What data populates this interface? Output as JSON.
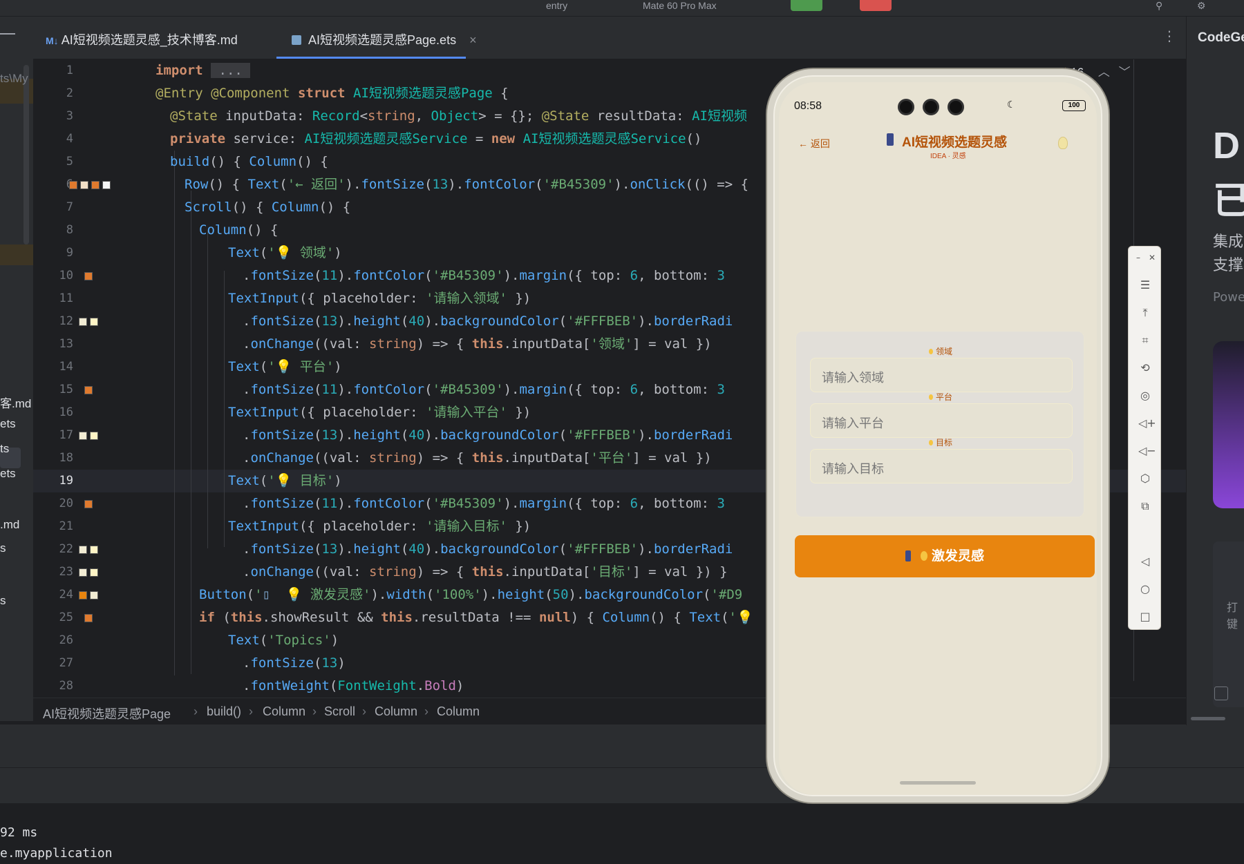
{
  "topbar": {
    "device_label": "entry",
    "target_label": "Mate 60 Pro Max"
  },
  "project_items": [
    "ts\\My",
    "客.md",
    "ets",
    "ts",
    "ets",
    ".md",
    "s",
    "s"
  ],
  "tabs": [
    {
      "icon": "M↓",
      "label": "AI短视频选题灵感_技术博客.md"
    },
    {
      "icon": "ets-file",
      "label": "AI短视频选题灵感Page.ets",
      "close": "×"
    }
  ],
  "editor": {
    "warnings": "16",
    "line_numbers": [
      "1",
      "2",
      "3",
      "4",
      "5",
      "6",
      "7",
      "8",
      "9",
      "10",
      "11",
      "12",
      "13",
      "14",
      "15",
      "16",
      "17",
      "18",
      "19",
      "20",
      "21",
      "22",
      "23",
      "24",
      "25",
      "26",
      "27",
      "28"
    ],
    "current_line": "19"
  },
  "breadcrumb": [
    "AI短视频选题灵感Page",
    "build()",
    "Column",
    "Scroll",
    "Column",
    "Column"
  ],
  "bottom_panel": {
    "lines": [
      "92 ms",
      "e.myapplication"
    ]
  },
  "right_panel": {
    "title": "CodeGe",
    "big1": "D",
    "big2": "已",
    "txt1": "集成",
    "txt2": "支撑",
    "txt3": "Powe",
    "txt4": "打",
    "txt5": "键"
  },
  "phone": {
    "time": "08:58",
    "battery": "100",
    "back_label": "← 返回",
    "title": "AI短视频选题灵感",
    "subtitle": "IDEA · 灵感",
    "fields": [
      {
        "label": "领域",
        "placeholder": "请输入领域"
      },
      {
        "label": "平台",
        "placeholder": "请输入平台"
      },
      {
        "label": "目标",
        "placeholder": "请输入目标"
      }
    ],
    "button_label": "激发灵感"
  }
}
